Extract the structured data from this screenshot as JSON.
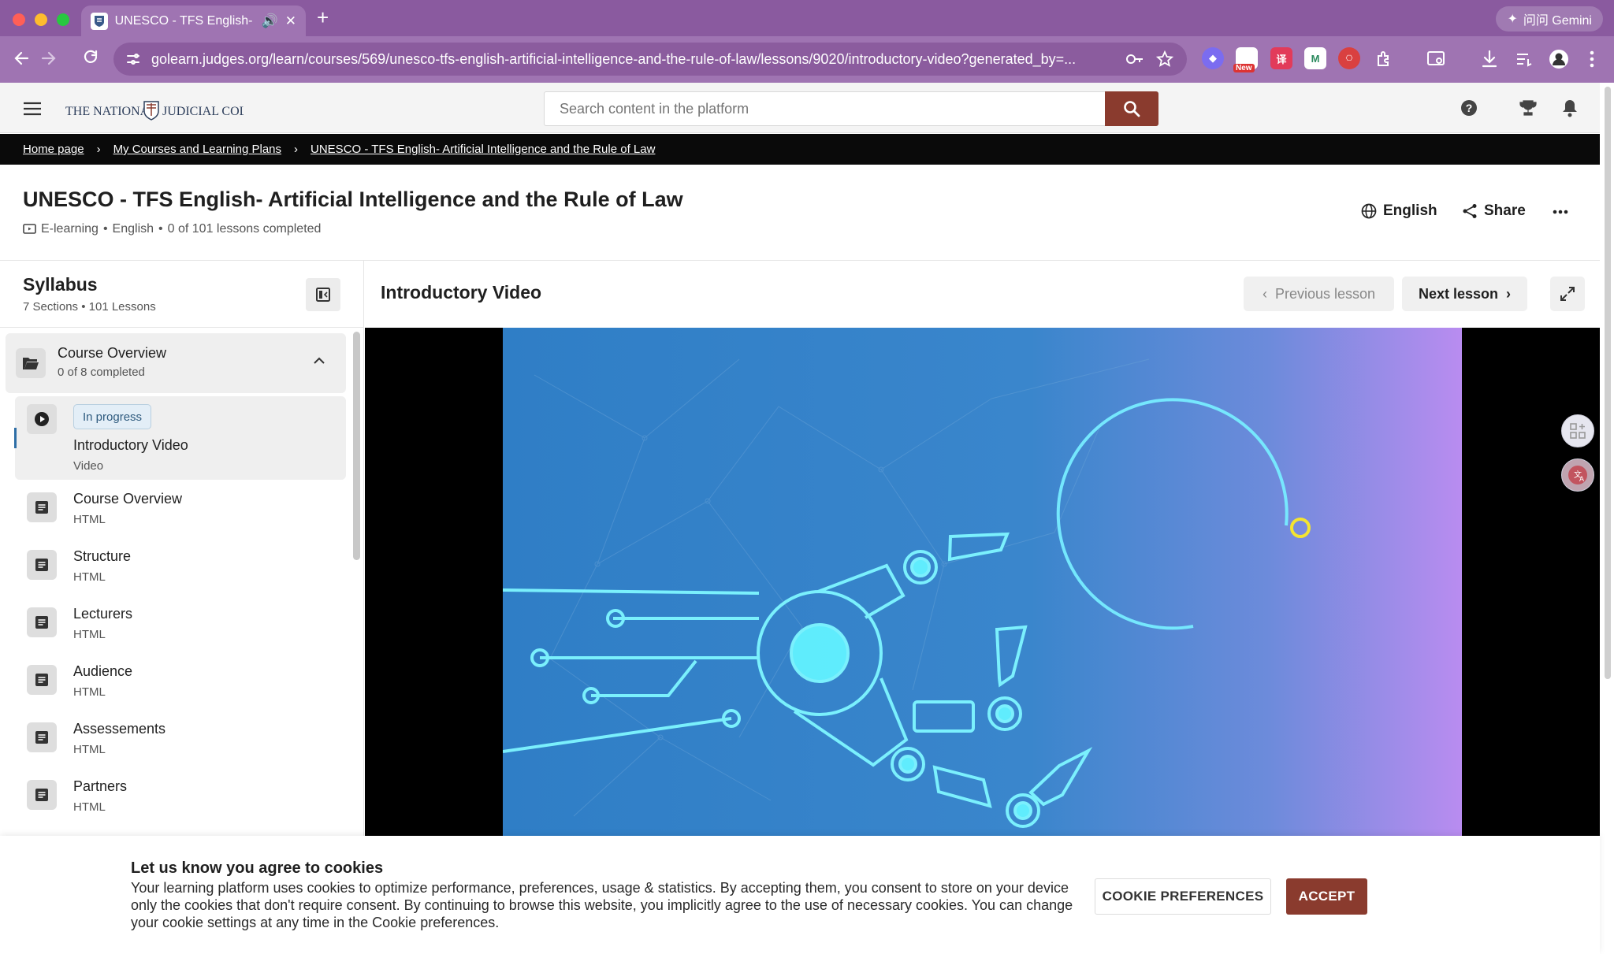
{
  "browser": {
    "tab_title": "UNESCO - TFS English- A",
    "url": "golearn.judges.org/learn/courses/569/unesco-tfs-english-artificial-intelligence-and-the-rule-of-law/lessons/9020/introductory-video?generated_by=...",
    "gemini_label": "问问 Gemini",
    "ext_new_badge": "New"
  },
  "header": {
    "logo_text": "THE NATIONAL JUDICIAL COLLEGE",
    "search_placeholder": "Search content in the platform"
  },
  "breadcrumb": [
    "Home page",
    "My Courses and Learning Plans",
    "UNESCO - TFS English- Artificial Intelligence and the Rule of Law"
  ],
  "course": {
    "title": "UNESCO - TFS English- Artificial Intelligence and the Rule of Law",
    "type": "E-learning",
    "language": "English",
    "progress": "0 of 101 lessons completed",
    "language_button": "English",
    "share_button": "Share"
  },
  "syllabus": {
    "title": "Syllabus",
    "sections_count": "7 Sections",
    "lessons_count": "101 Lessons",
    "section": {
      "title": "Course Overview",
      "progress": "0 of 8 completed"
    },
    "lessons": [
      {
        "badge": "In progress",
        "title": "Introductory Video",
        "type": "Video"
      },
      {
        "title": "Course Overview",
        "type": "HTML"
      },
      {
        "title": "Structure",
        "type": "HTML"
      },
      {
        "title": "Lecturers",
        "type": "HTML"
      },
      {
        "title": "Audience",
        "type": "HTML"
      },
      {
        "title": "Assessements",
        "type": "HTML"
      },
      {
        "title": "Partners",
        "type": "HTML"
      }
    ]
  },
  "lesson": {
    "title": "Introductory Video",
    "prev_label": "Previous lesson",
    "next_label": "Next lesson"
  },
  "cookie": {
    "title": "Let us know you agree to cookies",
    "text": "Your learning platform uses cookies to optimize performance, preferences, usage & statistics. By accepting them, you consent to store on your device only the cookies that don't require consent. By continuing to browse this website, you implicitly agree to the use of necessary cookies. You can change your cookie settings at any time in the Cookie preferences.",
    "preferences_label": "COOKIE PREFERENCES",
    "accept_label": "ACCEPT"
  },
  "colors": {
    "brand": "#8a3b2e",
    "chrome": "#9f74b2",
    "video_start": "#2f7ec6",
    "video_end": "#b98cf0"
  }
}
